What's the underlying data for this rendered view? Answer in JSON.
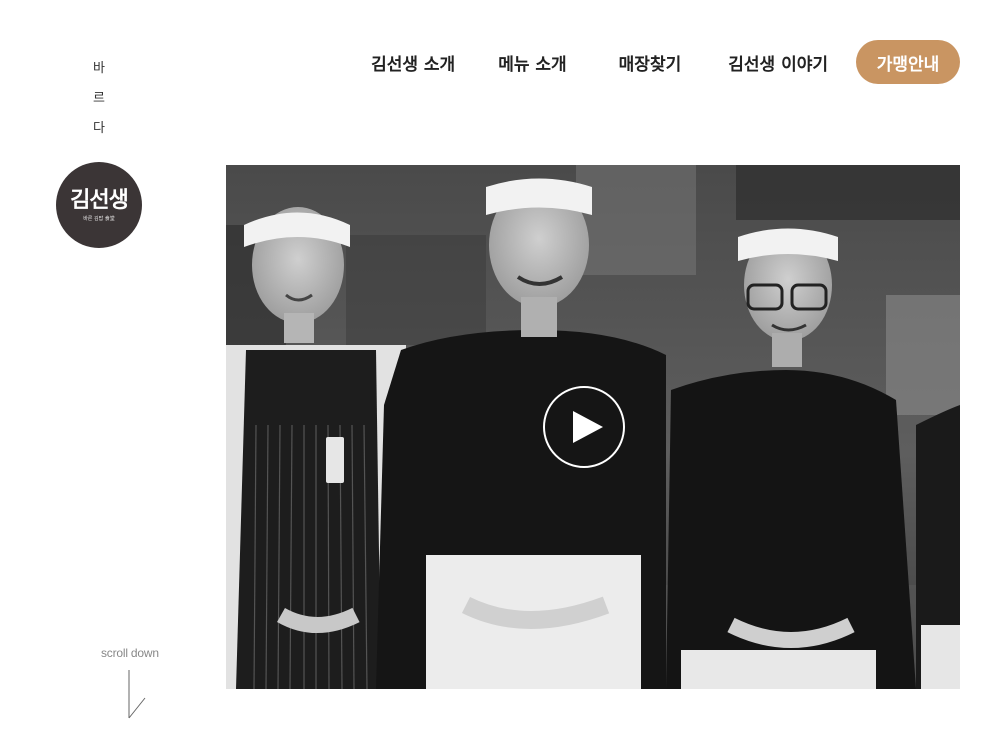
{
  "brand": {
    "tagline_chars": [
      "바",
      "르",
      "다"
    ],
    "logo_text": "김선생",
    "logo_subtext": "바른 김밥 食堂",
    "logo_color": "#3b3536"
  },
  "nav": {
    "items": [
      {
        "label": "김선생 소개"
      },
      {
        "label": "메뉴 소개"
      },
      {
        "label": "매장찾기"
      },
      {
        "label": "김선생 이야기"
      }
    ],
    "cta_label": "가맹안내",
    "cta_color": "#c99562"
  },
  "hero": {
    "play_icon": "play-icon"
  },
  "scroll": {
    "label": "scroll down"
  }
}
